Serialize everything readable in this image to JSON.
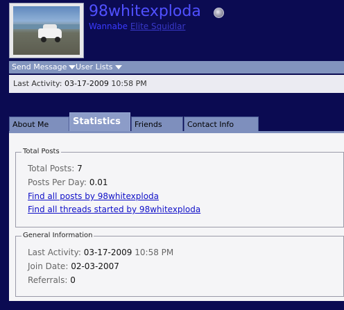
{
  "profile": {
    "username": "98whitexploda",
    "usertitle_prefix": "Wannabe",
    "usertitle_link": "Elite Squidlar"
  },
  "actions": {
    "send_message": "Send Message",
    "user_lists": "User Lists"
  },
  "last_activity_bar": {
    "label": "Last Activity:",
    "date": "03-17-2009",
    "time": "10:58 PM"
  },
  "tabs": [
    {
      "label": "About Me",
      "active": false
    },
    {
      "label": "Statistics",
      "active": true
    },
    {
      "label": "Friends",
      "active": false
    },
    {
      "label": "Contact Info",
      "active": false
    }
  ],
  "total_posts": {
    "legend": "Total Posts",
    "total_label": "Total Posts:",
    "total_value": "7",
    "per_day_label": "Posts Per Day:",
    "per_day_value": "0.01",
    "find_posts": "Find all posts by 98whitexploda",
    "find_threads": "Find all threads started by 98whitexploda"
  },
  "general_info": {
    "legend": "General Information",
    "last_activity_label": "Last Activity:",
    "last_activity_date": "03-17-2009",
    "last_activity_time": "10:58 PM",
    "join_label": "Join Date:",
    "join_value": "02-03-2007",
    "referrals_label": "Referrals:",
    "referrals_value": "0"
  },
  "colors": {
    "page_background": "#0b0b52",
    "username": "#5050ff",
    "bar": "#8294be",
    "link": "#1010c8"
  }
}
